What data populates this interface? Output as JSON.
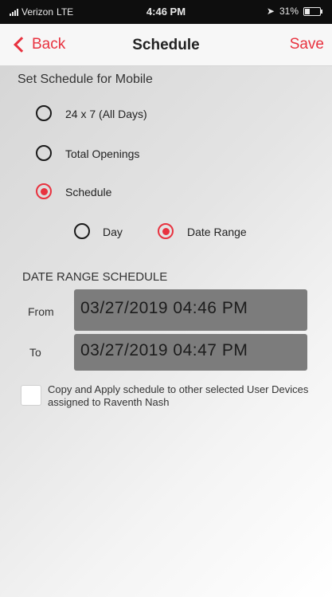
{
  "status_bar": {
    "carrier": "Verizon",
    "network": "LTE",
    "time": "4:46 PM",
    "battery": "31%"
  },
  "nav": {
    "back_label": "Back",
    "title": "Schedule",
    "save_label": "Save",
    "accent_color": "#e8323f"
  },
  "schedule": {
    "heading": "Set Schedule for Mobile",
    "options": [
      {
        "label": "24 x 7 (All Days)",
        "selected": false
      },
      {
        "label": "Total Openings",
        "selected": false
      },
      {
        "label": "Schedule",
        "selected": true
      }
    ],
    "sub_options": [
      {
        "label": "Day",
        "selected": false
      },
      {
        "label": "Date Range",
        "selected": true
      }
    ]
  },
  "date_range": {
    "heading": "DATE RANGE SCHEDULE",
    "from_label": "From",
    "from_value": "03/27/2019 04:46 PM",
    "to_label": "To",
    "to_value": "03/27/2019 04:47 PM"
  },
  "copy": {
    "checked": false,
    "text": "Copy and Apply schedule to other selected User Devices assigned to Raventh  Nash"
  }
}
